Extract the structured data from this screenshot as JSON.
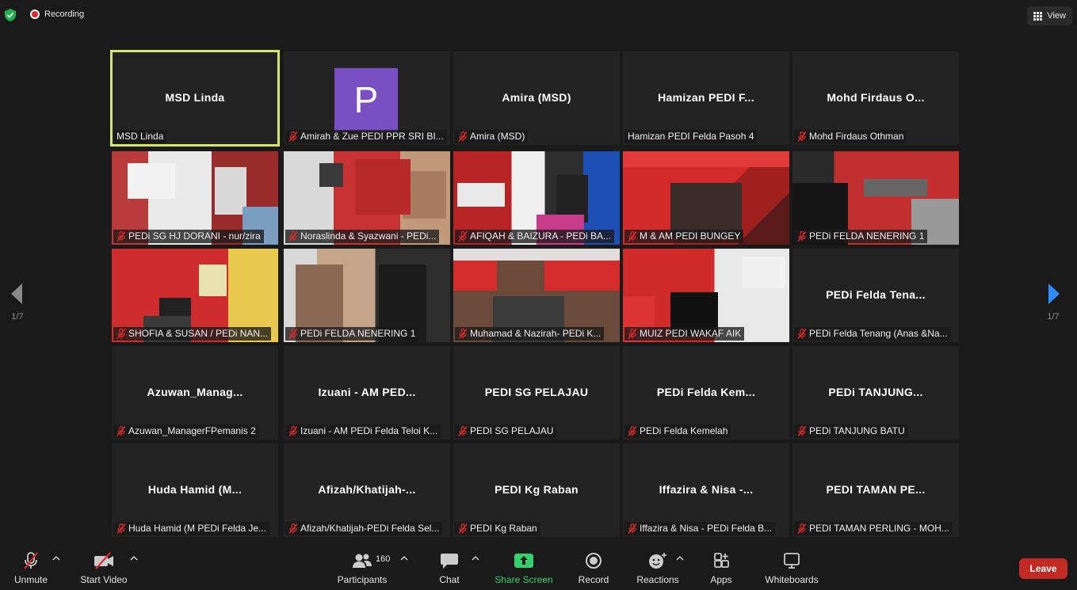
{
  "topbar": {
    "recording_label": "Recording",
    "view_label": "View",
    "icons": [
      "shield-check-icon",
      "record-icon",
      "grid-view-icon"
    ]
  },
  "navigation": {
    "left_page": "1/7",
    "right_page": "1/7"
  },
  "tiles": [
    {
      "center": "MSD Linda",
      "label": "MSD Linda",
      "muted": false,
      "active": true,
      "scene": "none"
    },
    {
      "center": "",
      "label": "Amirah & Zue PEDI PPR SRI BI...",
      "muted": true,
      "avatar": "P",
      "scene": "none"
    },
    {
      "center": "Amira (MSD)",
      "label": "Amira (MSD)",
      "muted": true,
      "scene": "none"
    },
    {
      "center": "Hamizan PEDI F...",
      "label": "Hamizan PEDI Felda Pasoh 4",
      "muted": false,
      "scene": "none"
    },
    {
      "center": "Mohd Firdaus O...",
      "label": "Mohd Firdaus Othman",
      "muted": true,
      "scene": "none"
    },
    {
      "center": "",
      "label": "PEDi SG HJ DORANI - nur/zira",
      "muted": true,
      "scene": "s1"
    },
    {
      "center": "",
      "label": "Noraslinda & Syazwani - PEDi...",
      "muted": true,
      "scene": "s2"
    },
    {
      "center": "",
      "label": "AFIQAH & BAIZURA - PEDi BA...",
      "muted": true,
      "scene": "s3"
    },
    {
      "center": "",
      "label": "M & AM PEDI BUNGEY",
      "muted": true,
      "scene": "s4"
    },
    {
      "center": "",
      "label": "PEDi FELDA NENERING 1",
      "muted": true,
      "scene": "s5"
    },
    {
      "center": "",
      "label": "SHOFIA & SUSAN / PEDi NAN...",
      "muted": true,
      "scene": "s6"
    },
    {
      "center": "",
      "label": "PEDi FELDA NENERING 1",
      "muted": true,
      "scene": "s7"
    },
    {
      "center": "",
      "label": "Muhamad & Nazirah- PEDi K...",
      "muted": true,
      "scene": "s8"
    },
    {
      "center": "",
      "label": "MUIZ PEDI WAKAF AIK",
      "muted": true,
      "scene": "s9"
    },
    {
      "center": "PEDi Felda Tena...",
      "label": "PEDi Felda Tenang (Anas &Na...",
      "muted": true,
      "scene": "none"
    },
    {
      "center": "Azuwan_Manag...",
      "label": "Azuwan_ManagerFPemanis 2",
      "muted": true,
      "scene": "none"
    },
    {
      "center": "Izuani - AM PED...",
      "label": "Izuani - AM PEDi Felda Teloi K...",
      "muted": true,
      "scene": "none"
    },
    {
      "center": "PEDI SG PELAJAU",
      "label": "PEDI SG PELAJAU",
      "muted": true,
      "scene": "none"
    },
    {
      "center": "PEDi Felda Kem...",
      "label": "PEDi Felda Kemelah",
      "muted": true,
      "scene": "none"
    },
    {
      "center": "PEDi TANJUNG...",
      "label": "PEDi TANJUNG BATU",
      "muted": true,
      "scene": "none"
    },
    {
      "center": "Huda Hamid (M...",
      "label": "Huda Hamid (M PEDi Felda Je...",
      "muted": true,
      "scene": "none"
    },
    {
      "center": "Afizah/Khatijah-...",
      "label": "Afizah/Khatijah-PEDi Felda Sel...",
      "muted": true,
      "scene": "none"
    },
    {
      "center": "PEDI Kg Raban",
      "label": "PEDI Kg Raban",
      "muted": true,
      "scene": "none"
    },
    {
      "center": "Iffazira & Nisa -...",
      "label": "Iffazira & Nisa - PEDi Felda B...",
      "muted": true,
      "scene": "none"
    },
    {
      "center": "PEDI TAMAN PE...",
      "label": "PEDI TAMAN PERLING - MOH...",
      "muted": true,
      "scene": "none"
    }
  ],
  "toolbar": {
    "unmute": "Unmute",
    "start_video": "Start Video",
    "participants": "Participants",
    "participants_count": "160",
    "chat": "Chat",
    "share_screen": "Share Screen",
    "record": "Record",
    "reactions": "Reactions",
    "apps": "Apps",
    "whiteboards": "Whiteboards",
    "leave": "Leave"
  },
  "colors": {
    "background": "#1a1a1a",
    "tile": "#232323",
    "active_border": "#d6e86b",
    "share_green": "#2fd26b",
    "leave_red": "#c22a24",
    "nav_arrow_blue": "#2d8cff",
    "mute_red": "#e02828"
  }
}
